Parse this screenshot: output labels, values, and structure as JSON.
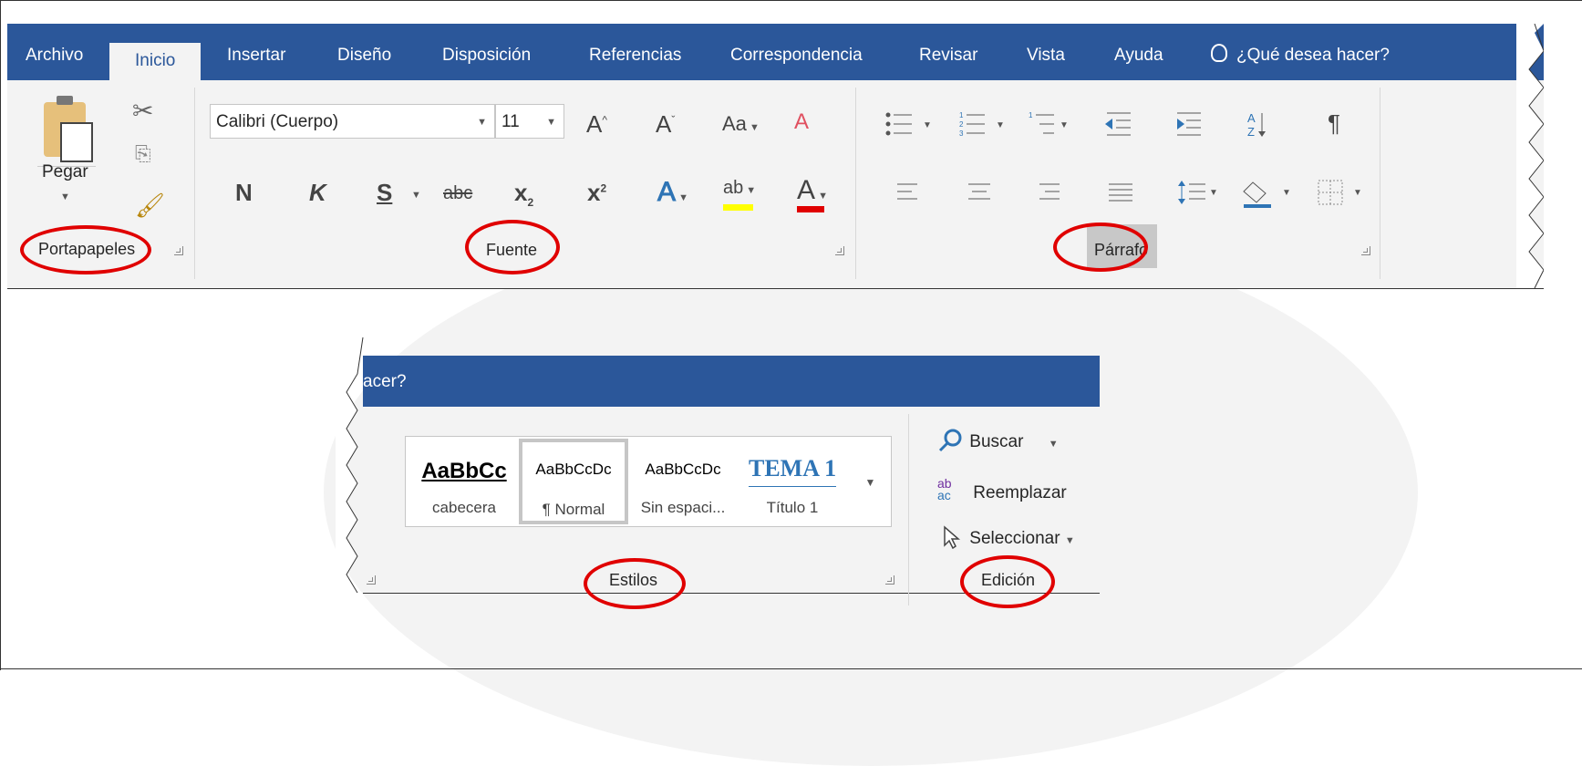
{
  "ribbon": {
    "tabs": [
      {
        "label": "Archivo"
      },
      {
        "label": "Inicio"
      },
      {
        "label": "Insertar"
      },
      {
        "label": "Diseño"
      },
      {
        "label": "Disposición"
      },
      {
        "label": "Referencias"
      },
      {
        "label": "Correspondencia"
      },
      {
        "label": "Revisar"
      },
      {
        "label": "Vista"
      },
      {
        "label": "Ayuda"
      }
    ],
    "active_tab": "Inicio",
    "tell_me": "¿Qué desea hacer?",
    "clipboard": {
      "paste_label": "Pegar",
      "group_label": "Portapapeles"
    },
    "font": {
      "font_name": "Calibri (Cuerpo)",
      "font_size": "11",
      "grow_label": "A",
      "shrink_label": "A",
      "case_label": "Aa",
      "bold_label": "N",
      "italic_label": "K",
      "underline_label": "S",
      "strike_label": "abc",
      "subscript_label": "x",
      "subscript_sub": "2",
      "superscript_label": "x",
      "superscript_sup": "2",
      "effects_label": "A",
      "highlight_label": "ab",
      "font_color_label": "A",
      "group_label": "Fuente",
      "highlight_color": "#ffff00",
      "font_color": "#e00000"
    },
    "paragraph": {
      "group_label": "Párrafo",
      "sort_label": "A Z",
      "pilcrow_label": "¶"
    }
  },
  "ribbon2": {
    "tab_fragment": "acer?",
    "styles": [
      {
        "sample": "AaBbCc",
        "name": "cabecera"
      },
      {
        "sample": "AaBbCcDc",
        "name": "¶ Normal"
      },
      {
        "sample": "AaBbCcDc",
        "name": "Sin espaci..."
      },
      {
        "sample": "TEMA 1",
        "name": "Título 1"
      }
    ],
    "styles_group_label": "Estilos",
    "editing": {
      "find_label": "Buscar",
      "replace_label": "Reemplazar",
      "replace_icon_top": "ab",
      "replace_icon_bottom": "ac",
      "select_label": "Seleccionar",
      "group_label": "Edición"
    }
  },
  "colors": {
    "ribbon_blue": "#2b579a",
    "ribbon_bg": "#f3f3f3",
    "annotation_red": "#e00000",
    "heading_blue": "#2e74b5"
  }
}
